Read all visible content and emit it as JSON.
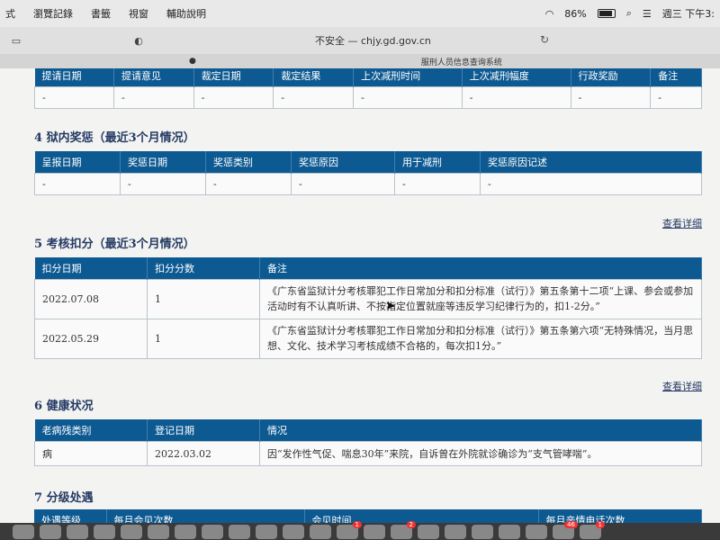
{
  "menubar": {
    "items": [
      "式",
      "瀏覽記錄",
      "書籤",
      "視窗",
      "輔助說明"
    ],
    "battery": "86%",
    "clock": "週三 下午3:"
  },
  "browser": {
    "address": "不安全 — chjy.gd.gov.cn",
    "tab_label": "服刑人员信息查询系统"
  },
  "table_top": {
    "headers": [
      "提请日期",
      "提请意见",
      "裁定日期",
      "裁定结果",
      "上次减刑时间",
      "上次减刑幅度",
      "行政奖励",
      "备注"
    ],
    "row": [
      "-",
      "-",
      "-",
      "-",
      "-",
      "-",
      "-",
      "-"
    ]
  },
  "section4": {
    "title": "4 狱内奖惩（最近3个月情况）",
    "headers": [
      "呈报日期",
      "奖惩日期",
      "奖惩类别",
      "奖惩原因",
      "用于减刑",
      "奖惩原因记述"
    ],
    "row": [
      "-",
      "-",
      "-",
      "-",
      "-",
      "-"
    ],
    "link": "查看详细"
  },
  "section5": {
    "title": "5 考核扣分（最近3个月情况）",
    "headers": [
      "扣分日期",
      "扣分分数",
      "备注"
    ],
    "rows": [
      [
        "2022.07.08",
        "1",
        "《广东省监狱计分考核罪犯工作日常加分和扣分标准（试行）》第五条第十二项“上课、参会或参加活动时有不认真听讲、不按指定位置就座等违反学习纪律行为的，扣1-2分。”"
      ],
      [
        "2022.05.29",
        "1",
        "《广东省监狱计分考核罪犯工作日常加分和扣分标准（试行）》第五条第六项“无特殊情况，当月思想、文化、技术学习考核成绩不合格的，每次扣1分。”"
      ]
    ],
    "link": "查看详细"
  },
  "section6": {
    "title": "6 健康状况",
    "headers": [
      "老病残类别",
      "登记日期",
      "情况"
    ],
    "rows": [
      [
        "病",
        "2022.03.02",
        "因“发作性气促、喘息30年”来院，自诉曾在外院就诊确诊为“支气管哮喘”。"
      ]
    ]
  },
  "section7": {
    "title": "7 分级处遇",
    "headers": [
      "处遇等级",
      "每月会见次数",
      "会见时间",
      "每月亲情电话次数"
    ]
  },
  "dock": {
    "badges": [
      "1",
      "2",
      "46",
      "1"
    ]
  }
}
